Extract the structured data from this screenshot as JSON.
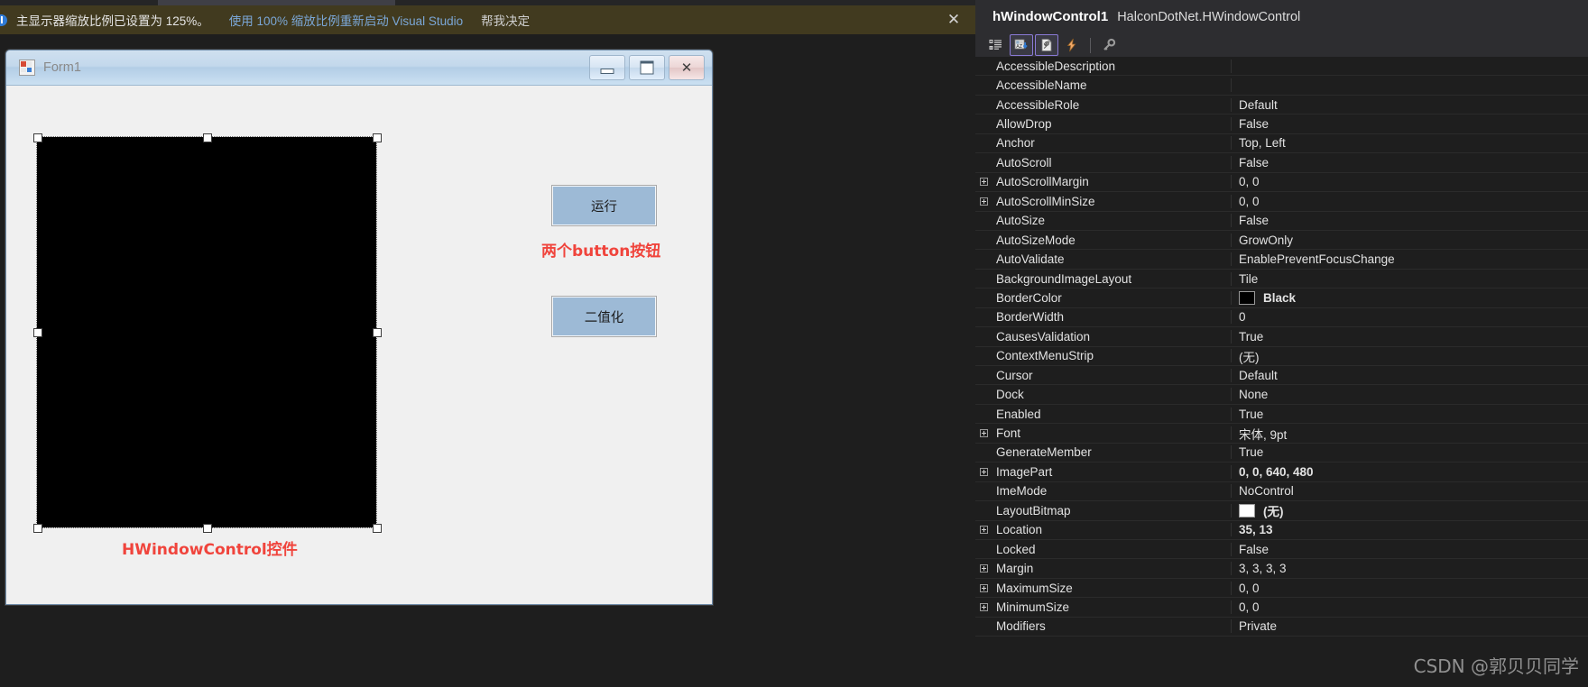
{
  "notification": {
    "icon": "info-icon",
    "message": "主显示器缩放比例已设置为 125%。",
    "restart_link": "使用 100% 缩放比例重新启动 Visual Studio",
    "decide_link": "帮我决定",
    "close_label": "✕",
    "bg_color": "#413a1f",
    "link_color": "#7ba7d7"
  },
  "designer": {
    "form": {
      "title": "Form1",
      "minimize_label": "",
      "maximize_label": "",
      "close_label": "✕",
      "hwindow_control": {
        "name": "hWindowControl1",
        "fill_color": "#000000"
      },
      "buttons": [
        {
          "label": "运行"
        },
        {
          "label": "二值化"
        }
      ],
      "annotations": [
        {
          "text": "两个button按钮",
          "color": "#f0443c"
        },
        {
          "text": "HWindowControl控件",
          "color": "#f0443c"
        }
      ]
    }
  },
  "properties_panel": {
    "object_name": "hWindowControl1",
    "object_type": "HalconDotNet.HWindowControl",
    "toolbar": [
      {
        "icon": "categorized-view-icon",
        "selected": false
      },
      {
        "icon": "alphabetical-sort-icon",
        "selected": true
      },
      {
        "icon": "properties-icon",
        "selected": true
      },
      {
        "icon": "events-lightning-icon",
        "selected": false
      },
      {
        "icon": "property-pages-key-icon",
        "selected": false
      }
    ],
    "rows": [
      {
        "name": "AccessibleDescription",
        "value": "",
        "expandable": false,
        "bold": false
      },
      {
        "name": "AccessibleName",
        "value": "",
        "expandable": false,
        "bold": false
      },
      {
        "name": "AccessibleRole",
        "value": "Default",
        "expandable": false,
        "bold": false
      },
      {
        "name": "AllowDrop",
        "value": "False",
        "expandable": false,
        "bold": false
      },
      {
        "name": "Anchor",
        "value": "Top, Left",
        "expandable": false,
        "bold": false
      },
      {
        "name": "AutoScroll",
        "value": "False",
        "expandable": false,
        "bold": false
      },
      {
        "name": "AutoScrollMargin",
        "value": "0, 0",
        "expandable": true,
        "bold": false
      },
      {
        "name": "AutoScrollMinSize",
        "value": "0, 0",
        "expandable": true,
        "bold": false
      },
      {
        "name": "AutoSize",
        "value": "False",
        "expandable": false,
        "bold": false
      },
      {
        "name": "AutoSizeMode",
        "value": "GrowOnly",
        "expandable": false,
        "bold": false
      },
      {
        "name": "AutoValidate",
        "value": "EnablePreventFocusChange",
        "expandable": false,
        "bold": false
      },
      {
        "name": "BackgroundImageLayout",
        "value": "Tile",
        "expandable": false,
        "bold": false
      },
      {
        "name": "BorderColor",
        "value": "Black",
        "expandable": false,
        "bold": true,
        "swatch": "#000000"
      },
      {
        "name": "BorderWidth",
        "value": "0",
        "expandable": false,
        "bold": false
      },
      {
        "name": "CausesValidation",
        "value": "True",
        "expandable": false,
        "bold": false
      },
      {
        "name": "ContextMenuStrip",
        "value": "(无)",
        "expandable": false,
        "bold": false
      },
      {
        "name": "Cursor",
        "value": "Default",
        "expandable": false,
        "bold": false
      },
      {
        "name": "Dock",
        "value": "None",
        "expandable": false,
        "bold": false
      },
      {
        "name": "Enabled",
        "value": "True",
        "expandable": false,
        "bold": false
      },
      {
        "name": "Font",
        "value": "宋体, 9pt",
        "expandable": true,
        "bold": false
      },
      {
        "name": "GenerateMember",
        "value": "True",
        "expandable": false,
        "bold": false
      },
      {
        "name": "ImagePart",
        "value": "0, 0, 640, 480",
        "expandable": true,
        "bold": true
      },
      {
        "name": "ImeMode",
        "value": "NoControl",
        "expandable": false,
        "bold": false
      },
      {
        "name": "LayoutBitmap",
        "value": "(无)",
        "expandable": false,
        "bold": false,
        "swatch": "#ffffff"
      },
      {
        "name": "Location",
        "value": "35, 13",
        "expandable": true,
        "bold": true
      },
      {
        "name": "Locked",
        "value": "False",
        "expandable": false,
        "bold": false
      },
      {
        "name": "Margin",
        "value": "3, 3, 3, 3",
        "expandable": true,
        "bold": false
      },
      {
        "name": "MaximumSize",
        "value": "0, 0",
        "expandable": true,
        "bold": false
      },
      {
        "name": "MinimumSize",
        "value": "0, 0",
        "expandable": true,
        "bold": false
      },
      {
        "name": "Modifiers",
        "value": "Private",
        "expandable": false,
        "bold": false
      }
    ]
  },
  "watermark": {
    "text": "CSDN @郭贝贝同学"
  }
}
